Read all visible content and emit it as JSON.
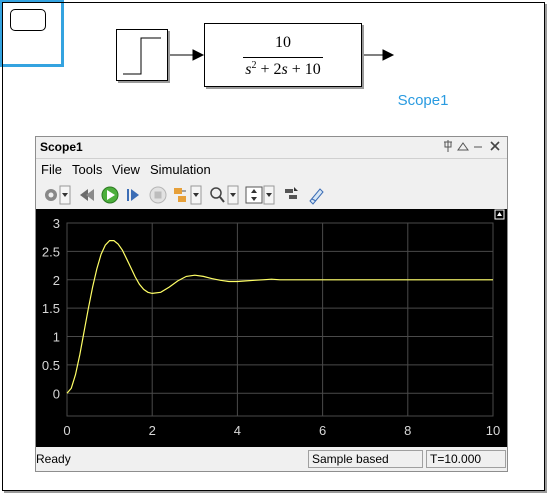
{
  "model": {
    "tf_numerator": "10",
    "tf_denominator_parts": [
      "s",
      "2",
      " + 2",
      "s",
      " + 10"
    ],
    "scope_label": "Scope1"
  },
  "window": {
    "title": "Scope1",
    "controls": {
      "pin": "pin-icon",
      "undock": "undock-icon",
      "minimize": "minimize-icon",
      "close": "close-icon"
    }
  },
  "menu": [
    "File",
    "Tools",
    "View",
    "Simulation"
  ],
  "toolbar": [
    "parameters-gear-icon",
    "step-back-icon",
    "run-icon",
    "step-forward-icon",
    "stop-icon",
    "signal-selection-icon",
    "zoom-icon",
    "autoscale-icon",
    "restore-layout-icon",
    "highlight-block-icon"
  ],
  "status": {
    "state": "Ready",
    "sampling": "Sample based",
    "time": "T=10.000"
  },
  "colors": {
    "trace": "#ffff66",
    "grid": "#4a4a4a",
    "axis_text": "#d7d7d7",
    "highlight": "#34a3e0"
  },
  "chart_data": {
    "type": "line",
    "title": "",
    "xlabel": "",
    "ylabel": "",
    "xlim": [
      0,
      10
    ],
    "ylim": [
      -0.4,
      3
    ],
    "xticks": [
      0,
      2,
      4,
      6,
      8,
      10
    ],
    "yticks": [
      0,
      0.5,
      1,
      1.5,
      2,
      2.5,
      3
    ],
    "xtick_labels": [
      "0",
      "2",
      "4",
      "6",
      "8",
      "10"
    ],
    "ytick_labels": [
      "0",
      "0.5",
      "1",
      "1.5",
      "2",
      "2.5",
      "3"
    ],
    "grid": true,
    "series": [
      {
        "x": [
          0,
          0.1,
          0.2,
          0.3,
          0.4,
          0.5,
          0.6,
          0.7,
          0.8,
          0.9,
          1.0,
          1.1,
          1.2,
          1.3,
          1.4,
          1.5,
          1.6,
          1.7,
          1.8,
          1.9,
          2.0,
          2.2,
          2.4,
          2.6,
          2.8,
          3.0,
          3.2,
          3.4,
          3.6,
          3.8,
          4.0,
          4.2,
          4.4,
          4.6,
          4.8,
          5.0,
          5.5,
          6.0,
          6.5,
          7.0,
          8.0,
          9.0,
          10.0
        ],
        "y": [
          0,
          0.09,
          0.33,
          0.68,
          1.08,
          1.49,
          1.87,
          2.19,
          2.45,
          2.61,
          2.69,
          2.69,
          2.63,
          2.52,
          2.37,
          2.21,
          2.05,
          1.92,
          1.83,
          1.78,
          1.76,
          1.78,
          1.87,
          1.98,
          2.06,
          2.08,
          2.06,
          2.02,
          1.99,
          1.97,
          1.97,
          1.98,
          1.99,
          2.0,
          2.01,
          2.0,
          2.0,
          2.0,
          2.0,
          2.0,
          2.0,
          2.0,
          2.0
        ]
      }
    ]
  }
}
